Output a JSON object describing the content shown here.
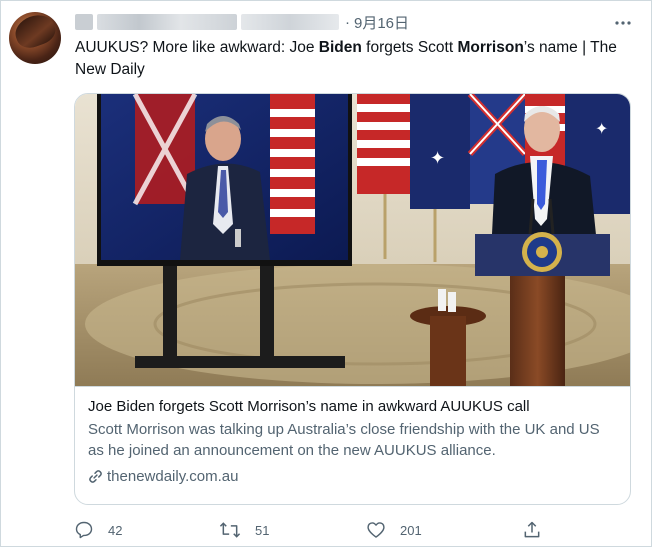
{
  "header": {
    "separator": "·",
    "date": "9月16日"
  },
  "tweet": {
    "text_parts": [
      "AUUKUS? More like awkward: Joe ",
      "Biden",
      " forgets Scott ",
      "Morrison",
      "’s name | The New Daily"
    ]
  },
  "card": {
    "title": "Joe Biden forgets Scott Morrison’s name in awkward AUUKUS call",
    "description": "Scott Morrison was talking up Australia’s close friendship with the UK and US as he joined an announcement on the new AUUKUS alliance.",
    "domain": "thenewdaily.com.au",
    "domain_icon": "link-icon"
  },
  "actions": {
    "reply_count": "42",
    "retweet_count": "51",
    "like_count": "201",
    "reply_icon": "reply-icon",
    "retweet_icon": "retweet-icon",
    "like_icon": "heart-icon",
    "share_icon": "share-icon"
  },
  "colors": {
    "text": "#0f1419",
    "secondary": "#536471",
    "border": "#cfd9de"
  }
}
